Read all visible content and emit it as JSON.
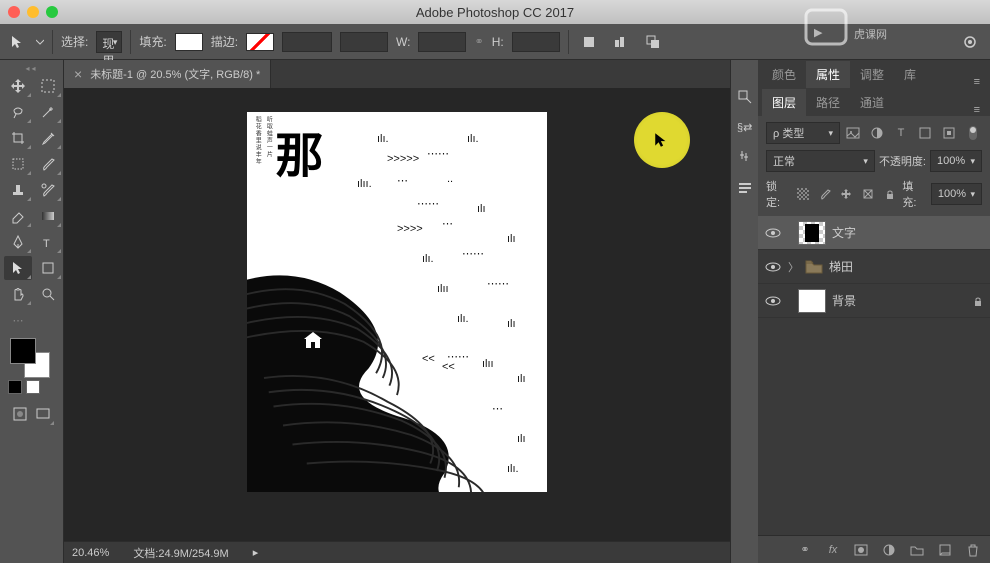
{
  "app_title": "Adobe Photoshop CC 2017",
  "watermark": "虎课网",
  "options_bar": {
    "select_label": "选择:",
    "select_value": "现用图层",
    "fill_label": "填充:",
    "stroke_label": "描边:",
    "w_label": "W:",
    "h_label": "H:"
  },
  "doc_tab": {
    "title": "未标题-1 @ 20.5% (文字, RGB/8) *"
  },
  "artboard": {
    "big_char": "那",
    "vert_text_1": "稻花香里说丰年",
    "vert_text_2": "听取蛙声一片"
  },
  "status_bar": {
    "zoom": "20.46%",
    "doc_info": "文档:24.9M/254.9M",
    "arrow": "▸"
  },
  "panels": {
    "tabs1": [
      "颜色",
      "属性",
      "调整",
      "库"
    ],
    "tabs2": [
      "图层",
      "路径",
      "通道"
    ],
    "layers": {
      "filter_label": "ρ 类型",
      "blend_mode": "正常",
      "opacity_label": "不透明度:",
      "opacity_value": "100%",
      "lock_label": "锁定:",
      "fill_label": "填充:",
      "fill_value": "100%",
      "items": [
        {
          "name": "文字",
          "type": "raster",
          "selected": true
        },
        {
          "name": "梯田",
          "type": "group",
          "selected": false
        },
        {
          "name": "背景",
          "type": "bg",
          "selected": false,
          "locked": true
        }
      ]
    }
  }
}
